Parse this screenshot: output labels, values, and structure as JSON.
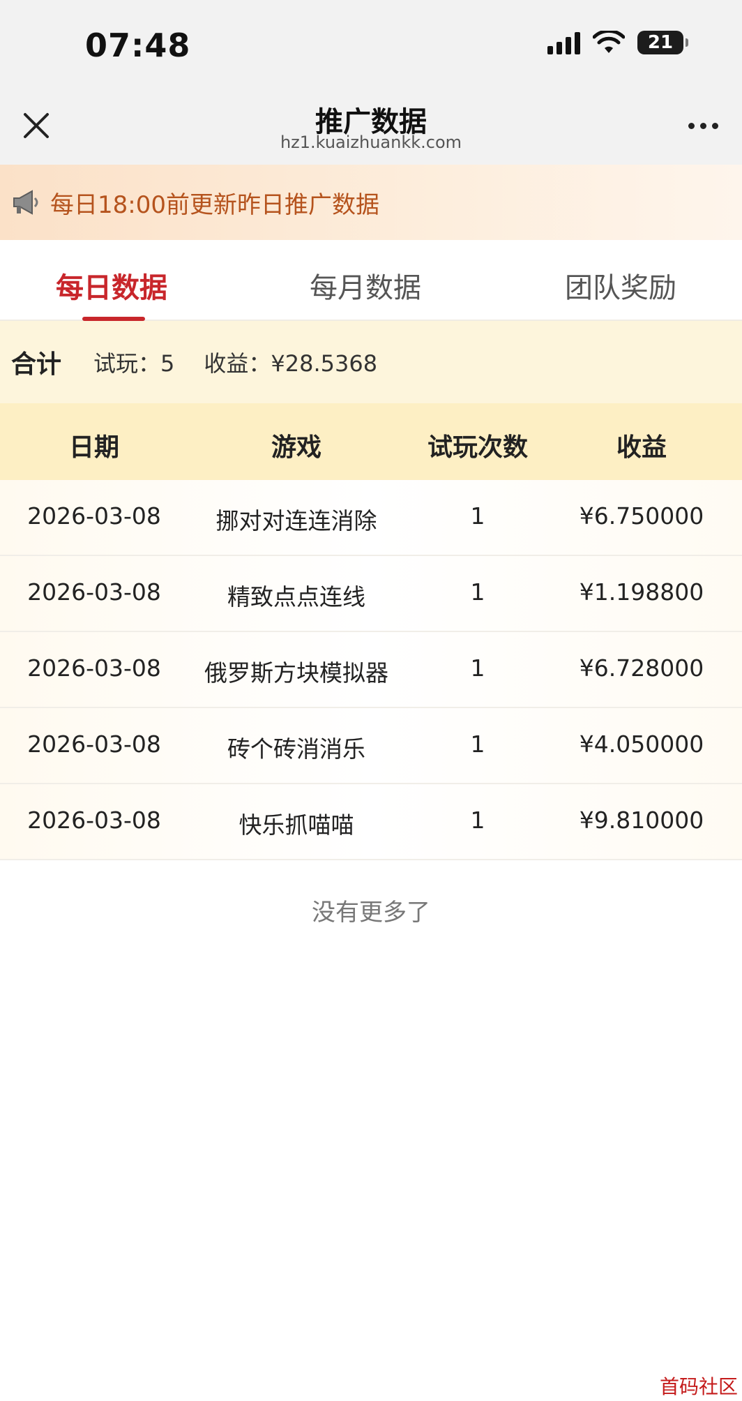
{
  "status_bar": {
    "time": "07:48",
    "battery": "21"
  },
  "nav": {
    "title": "推广数据",
    "subtitle": "hz1.kuaizhuankk.com"
  },
  "notice": {
    "text": "每日18:00前更新昨日推广数据",
    "icon": "megaphone-icon"
  },
  "tabs": [
    {
      "label": "每日数据",
      "active": true
    },
    {
      "label": "每月数据",
      "active": false
    },
    {
      "label": "团队奖励",
      "active": false
    }
  ],
  "summary": {
    "label": "合计",
    "trials": "试玩：5",
    "income": "收益：¥28.5368"
  },
  "table": {
    "headers": [
      "日期",
      "游戏",
      "试玩次数",
      "收益"
    ],
    "rows": [
      {
        "date": "2026-03-08",
        "game": "挪对对连连消除",
        "count": "1",
        "income": "¥6.750000"
      },
      {
        "date": "2026-03-08",
        "game": "精致点点连线",
        "count": "1",
        "income": "¥1.198800"
      },
      {
        "date": "2026-03-08",
        "game": "俄罗斯方块模拟器",
        "count": "1",
        "income": "¥6.728000"
      },
      {
        "date": "2026-03-08",
        "game": "砖个砖消消乐",
        "count": "1",
        "income": "¥4.050000"
      },
      {
        "date": "2026-03-08",
        "game": "快乐抓喵喵",
        "count": "1",
        "income": "¥9.810000"
      }
    ]
  },
  "footer": {
    "no_more": "没有更多了"
  },
  "watermark": "首码社区",
  "colors": {
    "accent": "#c8262b",
    "notice_text": "#b5531d",
    "summary_bg": "#fdf5dc",
    "header_bg": "#fdefc4"
  }
}
